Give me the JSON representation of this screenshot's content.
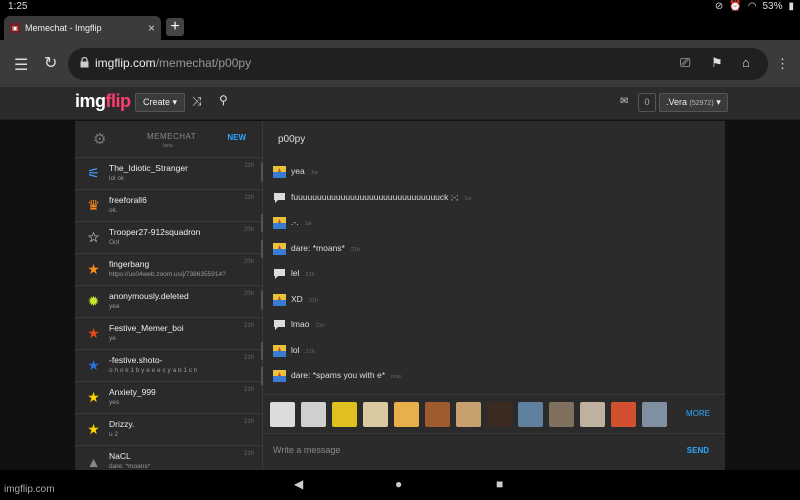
{
  "status": {
    "time": "1:25",
    "battery": "53%"
  },
  "browser": {
    "tab_title": "Memechat - Imgflip",
    "tab_close": "×",
    "new_tab": "+",
    "url_host": "imgflip.com",
    "url_path": "/memechat/p00py"
  },
  "site": {
    "logo_img": "img",
    "logo_flip": "flip",
    "create_label": "Create ▾",
    "notif_count": "0",
    "user_label": ".Vera",
    "user_points": "(52972)"
  },
  "sidebar": {
    "title": "MEMECHAT",
    "beta": "beta",
    "new_label": "NEW",
    "chats": [
      {
        "name": "The_Idiotic_Stranger",
        "preview": "lol ok",
        "time": "11h",
        "icon": "dash-icon",
        "color": "#4aa3ff"
      },
      {
        "name": "freeforall6",
        "preview": "ok.",
        "time": "11h",
        "icon": "crown-icon",
        "color": "#ff8c1a"
      },
      {
        "name": "Trooper27-912squadron",
        "preview": "Oof",
        "time": "20h",
        "icon": "star-outline-icon",
        "color": "#ffffff"
      },
      {
        "name": "fingerbang",
        "preview": "https://us04web.zoom.us/j/7386355914?",
        "time": "20h",
        "icon": "star-icon",
        "color": "#ff8c1a"
      },
      {
        "name": "anonymously.deleted",
        "preview": "yea",
        "time": "20h",
        "icon": "sun-icon",
        "color": "#c8e632"
      },
      {
        "name": "Festive_Memer_boi",
        "preview": "ye",
        "time": "21h",
        "icon": "star-icon",
        "color": "#e64a19"
      },
      {
        "name": "-festive.shoto-",
        "preview": "o h o k 1 b y e e e c y a b 1 c h",
        "time": "21h",
        "icon": "star-icon",
        "color": "#2a6fdb"
      },
      {
        "name": "Anxiety_999",
        "preview": "yes",
        "time": "21h",
        "icon": "star-icon",
        "color": "#ffd400"
      },
      {
        "name": "Drizzy.",
        "preview": "u 2",
        "time": "21h",
        "icon": "star-icon",
        "color": "#ffd400"
      },
      {
        "name": "NaCL",
        "preview": "dare: *moans*",
        "time": "21h",
        "icon": "triangle-icon",
        "color": "#888888"
      }
    ]
  },
  "chat": {
    "title": "p00py",
    "messages": [
      {
        "text": "yea",
        "time": "1w",
        "avatar": "user"
      },
      {
        "text": "fuuuuuuuuuuuuuuuuuuuuuuuuuuuuuuuck ;-;",
        "time": "1w",
        "avatar": "bubble"
      },
      {
        "text": ".-.",
        "time": "1w",
        "avatar": "user"
      },
      {
        "text": "dare: *moans*",
        "time": "21h",
        "avatar": "user"
      },
      {
        "text": "lel",
        "time": "21h",
        "avatar": "bubble"
      },
      {
        "text": "XD",
        "time": "21h",
        "avatar": "user"
      },
      {
        "text": "lmao",
        "time": "21h",
        "avatar": "bubble"
      },
      {
        "text": "lol",
        "time": "21h",
        "avatar": "user"
      },
      {
        "text": "dare: *spams you with e*",
        "time": "now",
        "avatar": "user"
      }
    ],
    "memes": [
      "#dcdcdc",
      "#cfcfcf",
      "#e0c020",
      "#d9c9a0",
      "#e8b04a",
      "#a05a30",
      "#c8a070",
      "#3a2a20",
      "#6080a0",
      "#807060",
      "#c0b0a0",
      "#d05030",
      "#8090a0"
    ],
    "more_label": "MORE",
    "input_placeholder": "Write a message",
    "send_label": "SEND"
  },
  "watermark": "imgflip.com"
}
